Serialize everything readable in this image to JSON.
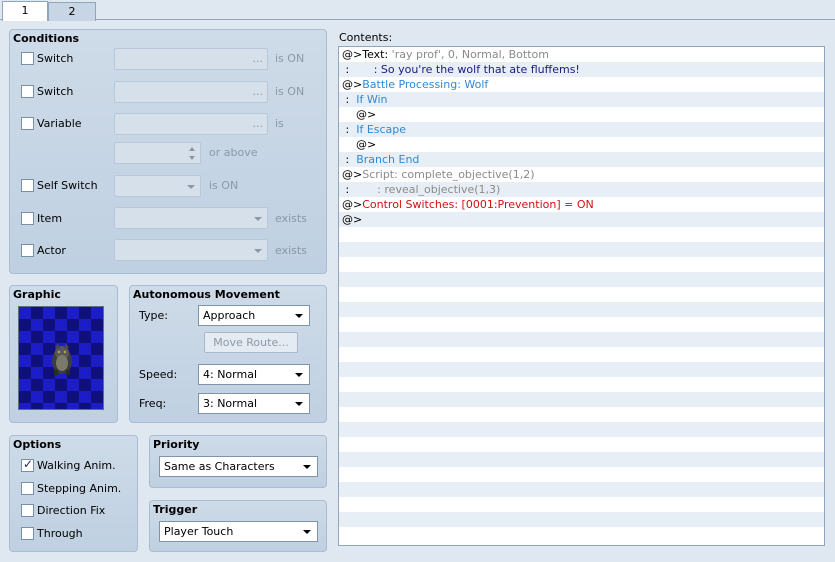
{
  "tabs": [
    "1",
    "2"
  ],
  "conditions": {
    "title": "Conditions",
    "switch1_label": "Switch",
    "switch1_state": "is ON",
    "switch2_label": "Switch",
    "switch2_state": "is ON",
    "variable_label": "Variable",
    "variable_state": "is",
    "or_above": "or above",
    "self_switch_label": "Self Switch",
    "self_switch_state": "is ON",
    "item_label": "Item",
    "item_state": "exists",
    "actor_label": "Actor",
    "actor_state": "exists",
    "dots": "..."
  },
  "graphic": {
    "title": "Graphic",
    "sprite_icon": "wolf-sprite-icon"
  },
  "autonomous": {
    "title": "Autonomous Movement",
    "type_label": "Type:",
    "type_value": "Approach",
    "move_route_label": "Move Route...",
    "speed_label": "Speed:",
    "speed_value": "4: Normal",
    "freq_label": "Freq:",
    "freq_value": "3: Normal"
  },
  "options": {
    "title": "Options",
    "walking": {
      "label": "Walking Anim.",
      "checked": true
    },
    "stepping": {
      "label": "Stepping Anim.",
      "checked": false
    },
    "direction_fix": {
      "label": "Direction Fix",
      "checked": false
    },
    "through": {
      "label": "Through",
      "checked": false
    }
  },
  "priority": {
    "title": "Priority",
    "value": "Same as Characters"
  },
  "trigger": {
    "title": "Trigger",
    "value": "Player Touch"
  },
  "contents": {
    "label": "Contents:",
    "lines": [
      {
        "p": "@>",
        "t": "Text: ",
        "x": "'ray prof', 0, Normal, Bottom"
      },
      {
        "p": " :       ",
        "t": ": So you're the wolf that ate fluffems!"
      },
      {
        "p": "@>",
        "t": "Battle Processing: Wolf"
      },
      {
        "p": " :  ",
        "t": "If Win"
      },
      {
        "p": "    @>"
      },
      {
        "p": " :  ",
        "t": "If Escape"
      },
      {
        "p": "    @>"
      },
      {
        "p": " :  ",
        "t": "Branch End"
      },
      {
        "p": "@>",
        "t": "Script: complete_objective(1,2)"
      },
      {
        "p": " :        ",
        "t": ": reveal_objective(1,3)"
      },
      {
        "p": "@>",
        "t": "Control Switches: [0001:Prevention] = ON"
      },
      {
        "p": "@>"
      }
    ]
  },
  "colors": {
    "text_gray": "#8a8a8a",
    "text_navy": "#1a1a80",
    "battle_blue": "#2d8ad6",
    "switch_red": "#d01010"
  }
}
